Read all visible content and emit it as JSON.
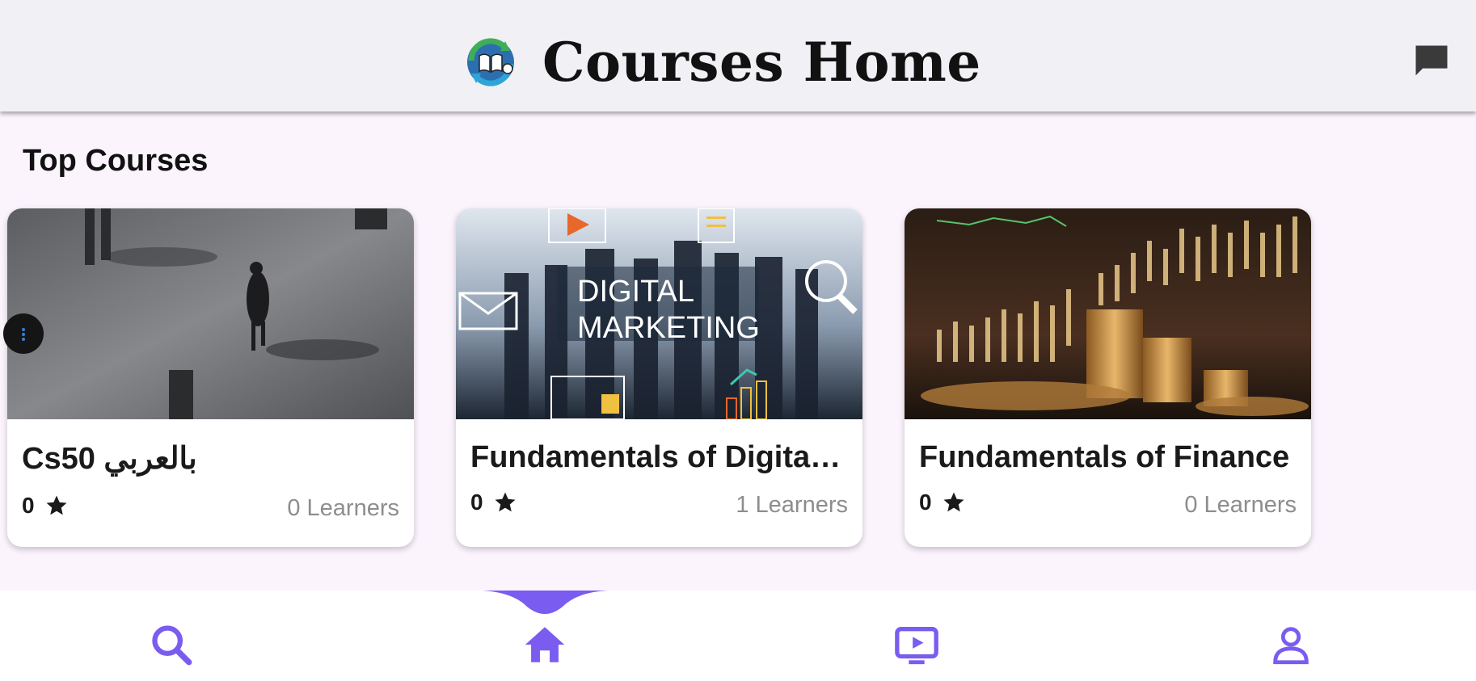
{
  "app_bar": {
    "title": "Courses Home",
    "logo_icon": "book-recycle-logo",
    "chat_icon": "chat-bubble-icon"
  },
  "section": {
    "title": "Top Courses"
  },
  "courses": [
    {
      "name": "Cs50 بالعربي",
      "rating": "0",
      "learners": "0 Learners",
      "image": "people-walking-photo"
    },
    {
      "name": "Fundamentals of Digital Marketing",
      "rating": "0",
      "learners": "1 Learners",
      "image": "digital-marketing-photo",
      "image_text": [
        "DIGITAL",
        "MARKETING"
      ]
    },
    {
      "name": "Fundamentals of Finance",
      "rating": "0",
      "learners": "0 Learners",
      "image": "finance-coins-chart-photo"
    }
  ],
  "bottom_nav": {
    "items": [
      "search-icon",
      "home-icon",
      "video-player-icon",
      "profile-icon"
    ],
    "active_index": 1,
    "accent_color": "#7a5cf0"
  },
  "colors": {
    "background": "#fcf4fd",
    "app_bar": "#f1f0f5",
    "accent": "#7a5cf0"
  }
}
